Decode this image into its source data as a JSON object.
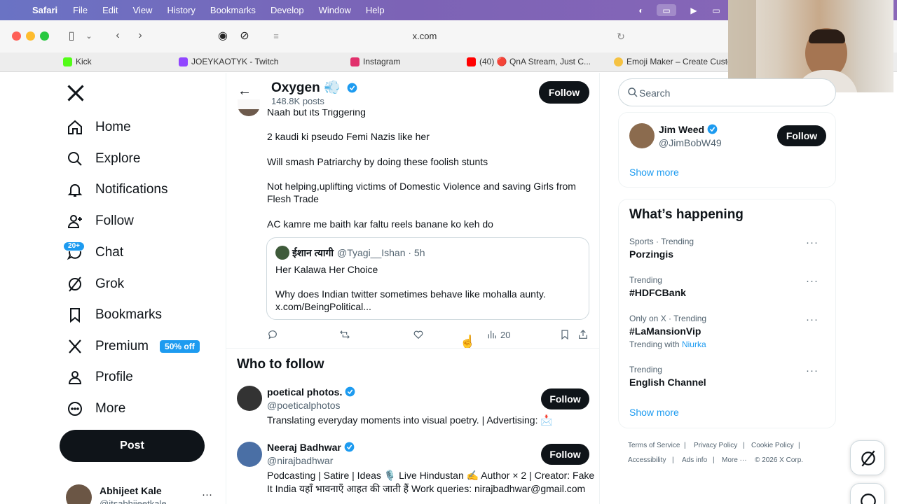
{
  "menubar": {
    "app": "Safari",
    "items": [
      "File",
      "Edit",
      "View",
      "History",
      "Bookmarks",
      "Develop",
      "Window",
      "Help"
    ]
  },
  "toolbar": {
    "url": "x.com"
  },
  "favorites": [
    {
      "label": "Kick",
      "color": "#53fc18"
    },
    {
      "label": "JOEYKAOTYK - Twitch",
      "color": "#9146ff"
    },
    {
      "label": "Instagram",
      "color": "#e1306c"
    },
    {
      "label": "(40) 🔴 QnA Stream, Just C...",
      "color": "#ff0000"
    },
    {
      "label": "Emoji Maker – Create Custo",
      "color": "#f5c242"
    }
  ],
  "nav": {
    "items": [
      {
        "label": "Home",
        "icon": "home-icon"
      },
      {
        "label": "Explore",
        "icon": "search-icon"
      },
      {
        "label": "Notifications",
        "icon": "bell-icon"
      },
      {
        "label": "Follow",
        "icon": "person-plus-icon"
      },
      {
        "label": "Chat",
        "icon": "chat-icon"
      },
      {
        "label": "Grok",
        "icon": "grok-icon"
      },
      {
        "label": "Bookmarks",
        "icon": "bookmark-icon"
      },
      {
        "label": "Premium",
        "icon": "x-logo-icon"
      },
      {
        "label": "Profile",
        "icon": "person-icon"
      },
      {
        "label": "More",
        "icon": "more-circle-icon"
      }
    ],
    "chat_badge": "20+",
    "premium_badge": "50% off",
    "post_button": "Post",
    "account": {
      "name": "Abhijeet Kale",
      "handle": "@itsabhijeetkale"
    }
  },
  "header": {
    "name": "Oxygen 💨",
    "posts": "148.8K posts",
    "follow": "Follow"
  },
  "tweet": {
    "lines": [
      "Naah but its Triggering",
      "2 kaudi ki pseudo Femi Nazis like her",
      "Will smash Patriarchy by doing these foolish stunts",
      "Not helping,uplifting victims of Domestic Violence and saving Girls from",
      "Flesh Trade",
      "AC kamre me baith kar faltu reels banane ko keh do"
    ],
    "quote": {
      "name": "ईशान त्यागी",
      "handle_time": "@Tyagi__Ishan · 5h",
      "line1": "Her Kalawa Her Choice",
      "line2": "Why does Indian twitter sometimes behave like mohalla aunty.",
      "line3": "x.com/BeingPolitical..."
    },
    "views": "20"
  },
  "who_to_follow": {
    "title": "Who to follow",
    "users": [
      {
        "name": "poetical photos.",
        "handle": "@poeticalphotos",
        "bio": [
          "Translating everyday moments into visual poetry. | Advertising: 📩"
        ],
        "button": "Follow"
      },
      {
        "name": "Neeraj Badhwar",
        "handle": "@nirajbadhwar",
        "bio": [
          "Podcasting | Satire | Ideas 🎙️ Live Hindustan ✍️ Author × 2 | Creator: Fake",
          "It India यहाँ भावनाएँ आहत की जाती हैं Work queries: nirajbadhwar@gmail.com"
        ],
        "button": "Follow"
      }
    ]
  },
  "right": {
    "search_placeholder": "Search",
    "suggested": {
      "name": "Jim Weed",
      "handle": "@JimBobW49",
      "button": "Follow"
    },
    "show_more": "Show more",
    "happening_title": "What’s happening",
    "trends": [
      {
        "meta": "Sports · Trending",
        "name": "Porzingis"
      },
      {
        "meta": "Trending",
        "name": "#HDFCBank"
      },
      {
        "meta": "Only on X · Trending",
        "name": "#LaMansionVip",
        "with_prefix": "Trending with",
        "with_link": "Niurka"
      },
      {
        "meta": "Trending",
        "name": "English Channel"
      }
    ],
    "footer": [
      "Terms of Service",
      "Privacy Policy",
      "Cookie Policy",
      "Accessibility",
      "Ads info",
      "More ···",
      "© 2026 X Corp."
    ]
  },
  "colors": {
    "accent": "#1d9bf0",
    "text": "#0f1419",
    "muted": "#536471"
  }
}
